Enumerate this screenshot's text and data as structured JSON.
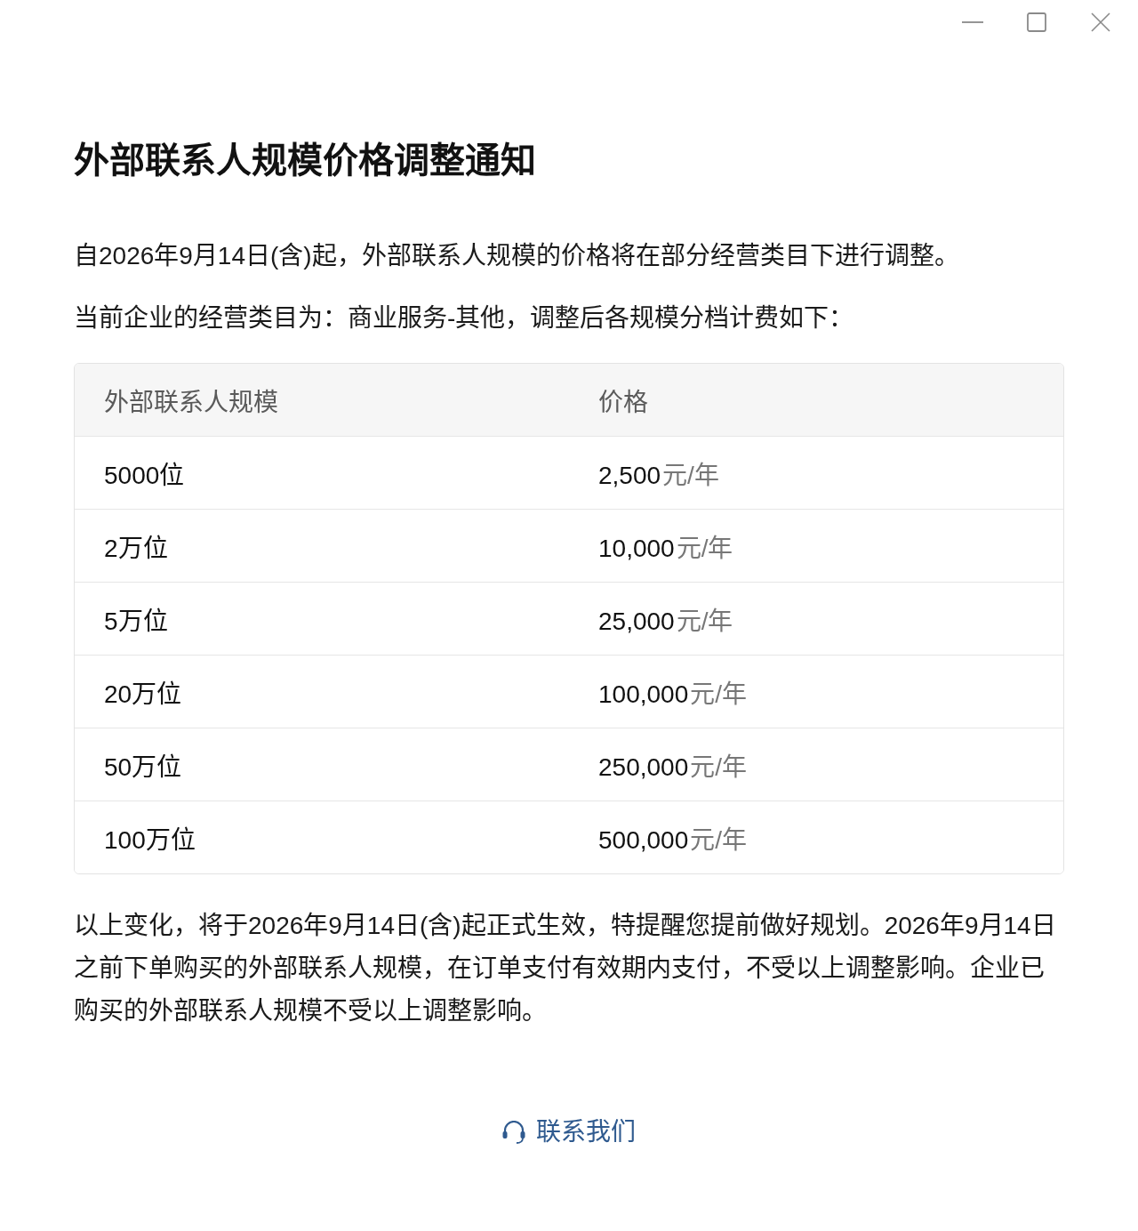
{
  "notice": {
    "title": "外部联系人规模价格调整通知",
    "paragraphs": [
      "自2026年9月14日(含)起，外部联系人规模的价格将在部分经营类目下进行调整。",
      "当前企业的经营类目为：商业服务-其他，调整后各规模分档计费如下："
    ]
  },
  "table": {
    "columns": [
      "外部联系人规模",
      "价格"
    ],
    "rows": [
      {
        "scale": "5000位",
        "amount": "2,500",
        "unit": "元/年"
      },
      {
        "scale": "2万位",
        "amount": "10,000",
        "unit": "元/年"
      },
      {
        "scale": "5万位",
        "amount": "25,000",
        "unit": "元/年"
      },
      {
        "scale": "20万位",
        "amount": "100,000",
        "unit": "元/年"
      },
      {
        "scale": "50万位",
        "amount": "250,000",
        "unit": "元/年"
      },
      {
        "scale": "100万位",
        "amount": "500,000",
        "unit": "元/年"
      }
    ]
  },
  "footer_note": "以上变化，将于2026年9月14日(含)起正式生效，特提醒您提前做好规划。2026年9月14日之前下单购买的外部联系人规模，在订单支付有效期内支付，不受以上调整影响。企业已购买的外部联系人规模不受以上调整影响。",
  "contact_link": {
    "label": "联系我们"
  }
}
